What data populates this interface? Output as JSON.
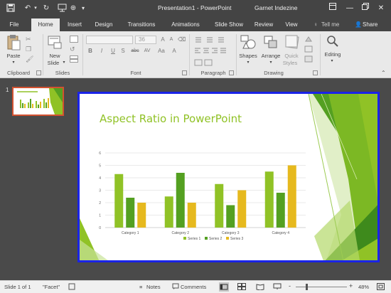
{
  "titlebar": {
    "qat": {
      "save": "save-icon",
      "undo": "undo-icon",
      "redo": "redo-icon",
      "present": "present-icon",
      "customize": "customize-icon"
    },
    "title": "Presentation1 - PowerPoint",
    "user": "Garnet Indezine"
  },
  "tabs": [
    "File",
    "Home",
    "Insert",
    "Design",
    "Transitions",
    "Animations",
    "Slide Show",
    "Review",
    "View"
  ],
  "tell_me": "Tell me",
  "share": "Share",
  "ribbon": {
    "groups": {
      "clipboard": "Clipboard",
      "slides": "Slides",
      "font": "Font",
      "paragraph": "Paragraph",
      "drawing": "Drawing"
    },
    "paste": "Paste",
    "new_slide_1": "New",
    "new_slide_2": "Slide",
    "font_size": "36",
    "format_buttons": [
      "B",
      "I",
      "U",
      "S",
      "abc",
      "AV",
      "Aa",
      "A"
    ],
    "shapes": "Shapes",
    "arrange": "Arrange",
    "quick_styles_1": "Quick",
    "quick_styles_2": "Styles",
    "editing": "Editing"
  },
  "thumb": {
    "number": "1"
  },
  "slide": {
    "title": "Aspect Ratio in PowerPoint"
  },
  "chart_data": {
    "type": "bar",
    "categories": [
      "Category 1",
      "Category 2",
      "Category 3",
      "Category 4"
    ],
    "series": [
      {
        "name": "Series 1",
        "values": [
          4.3,
          2.5,
          3.5,
          4.5
        ],
        "color": "#90c226"
      },
      {
        "name": "Series 2",
        "values": [
          2.4,
          4.4,
          1.8,
          2.8
        ],
        "color": "#54a021"
      },
      {
        "name": "Series 3",
        "values": [
          2,
          2,
          3,
          5
        ],
        "color": "#e6b91e"
      }
    ],
    "yticks": [
      "0",
      "1",
      "2",
      "3",
      "4",
      "5",
      "6"
    ],
    "ylim": [
      0,
      6
    ],
    "legend": "bottom",
    "grid": true
  },
  "status": {
    "slide_of": "Slide 1 of 1",
    "theme": "\"Facet\"",
    "notes": "Notes",
    "comments": "Comments",
    "zoom_minus": "-",
    "zoom_plus": "+",
    "zoom": "48%"
  },
  "colors": {
    "accent": "#90c226",
    "selection": "#1a23e8",
    "thumb_border": "#d35230"
  }
}
